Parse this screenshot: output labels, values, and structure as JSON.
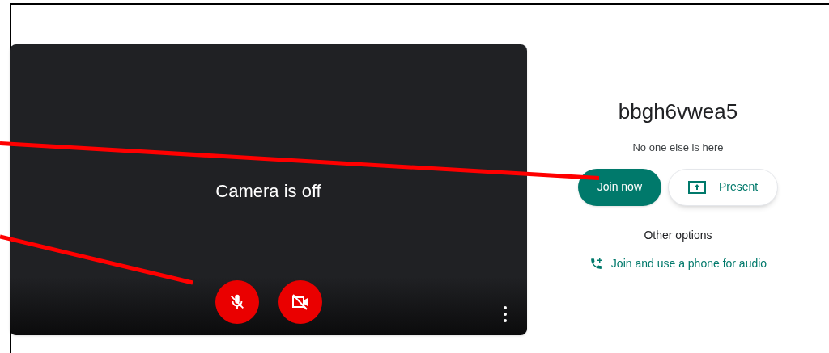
{
  "preview": {
    "message": "Camera is off",
    "microphone": {
      "on": false
    },
    "camera": {
      "on": false
    }
  },
  "meeting_code": "bbgh6vwea5",
  "status": "No one else is here",
  "buttons": [
    {
      "kind": "primary",
      "label": "Join now"
    },
    {
      "kind": "present",
      "label": "Present"
    }
  ],
  "other_options": {
    "heading": "Other options",
    "link": "Join and use a phone for audio"
  }
}
